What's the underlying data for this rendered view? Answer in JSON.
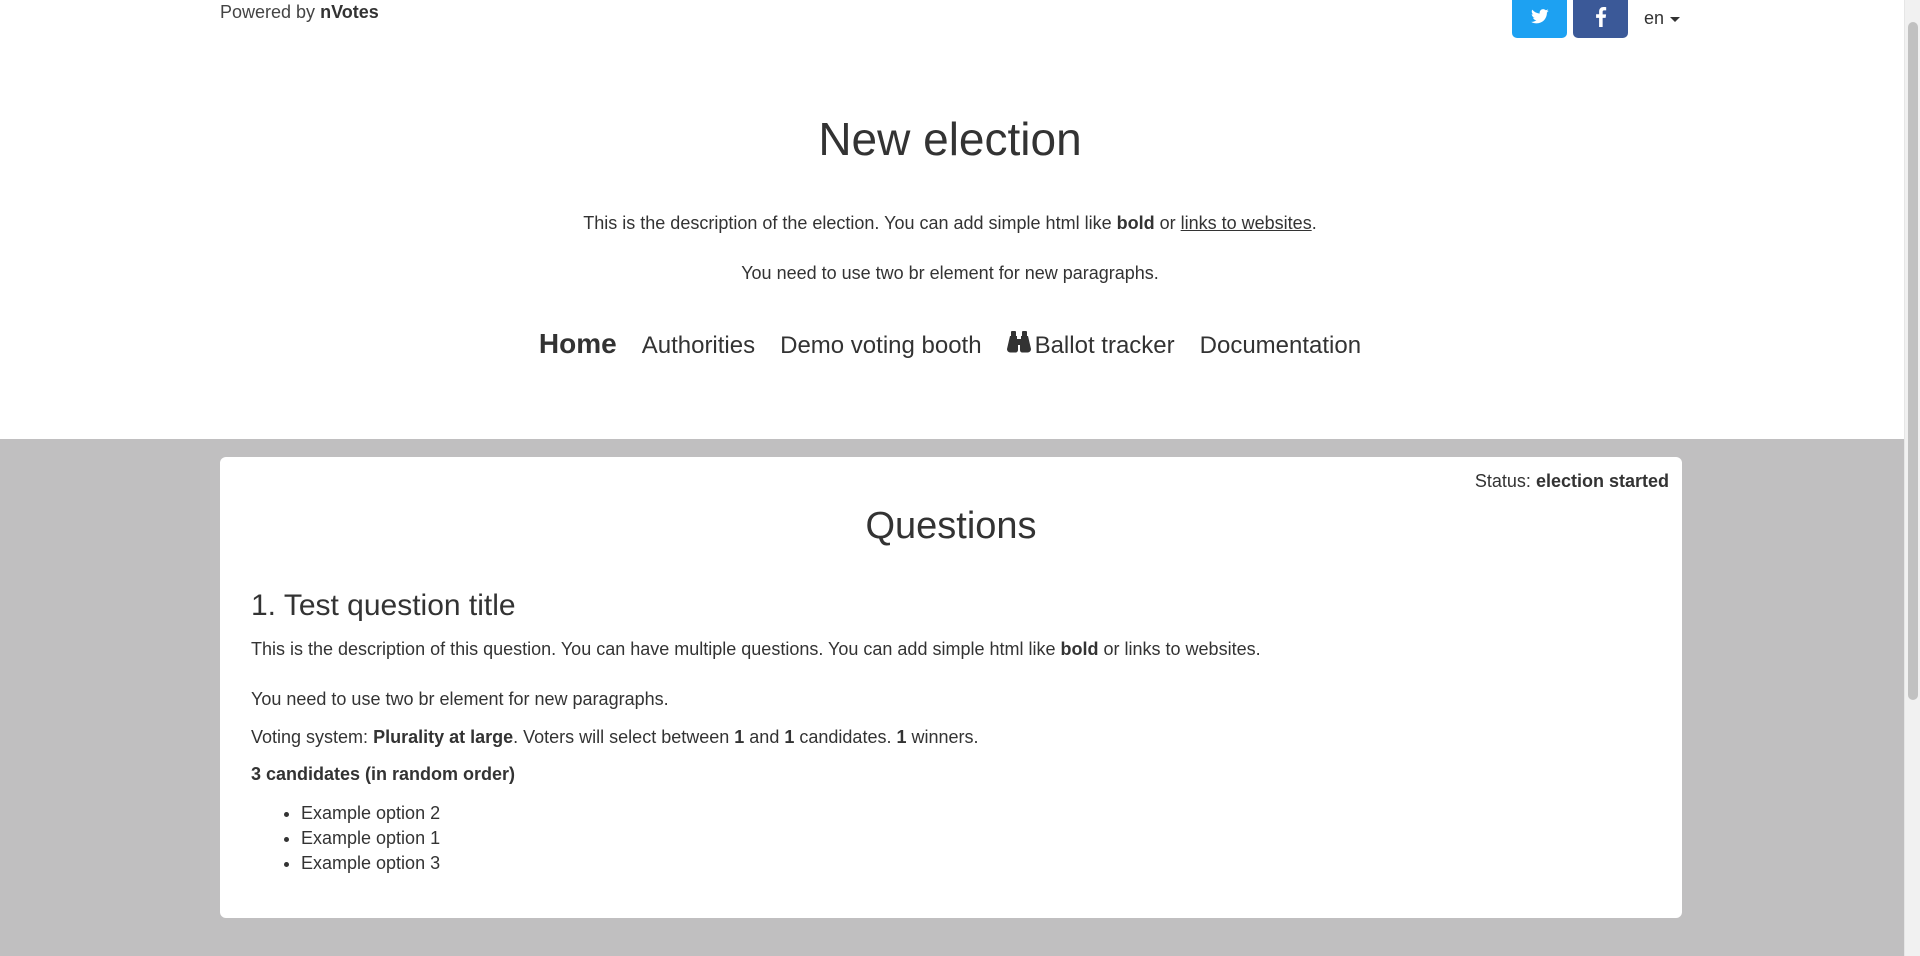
{
  "top": {
    "powered_prefix": "Powered by",
    "powered_brand": "nVotes",
    "twitter_color": "#1da1f2",
    "facebook_color": "#3b5998",
    "language": "en"
  },
  "election": {
    "title": "New election",
    "desc1_prefix": "This is the description of the election. You can add simple html like",
    "desc1_bold": "bold",
    "desc1_or": "or",
    "desc1_link": "links to websites",
    "desc1_end": ".",
    "desc2": "You need to use two br element for new paragraphs."
  },
  "nav": {
    "home": "Home",
    "authorities": "Authorities",
    "demo": "Demo voting booth",
    "tracker": "Ballot tracker",
    "docs": "Documentation"
  },
  "panel": {
    "status_label": "Status:",
    "status_value": "election started",
    "heading": "Questions",
    "question": {
      "title": "1. Test question title",
      "desc1_prefix": "This is the description of this question. You can have multiple questions. You can add simple html like",
      "desc1_bold": "bold",
      "desc1_suffix": "or links to websites.",
      "desc2": "You need to use two br element for new paragraphs.",
      "system_label": "Voting system:",
      "system_name": "Plurality at large",
      "system_mid1": ". Voters will select between",
      "min": "1",
      "and": "and",
      "max": "1",
      "mid2": "candidates.",
      "winners": "1",
      "winners_label": "winners.",
      "count_label": "3 candidates (in random order)",
      "options": [
        "Example option 2",
        "Example option 1",
        "Example option 3"
      ]
    }
  }
}
